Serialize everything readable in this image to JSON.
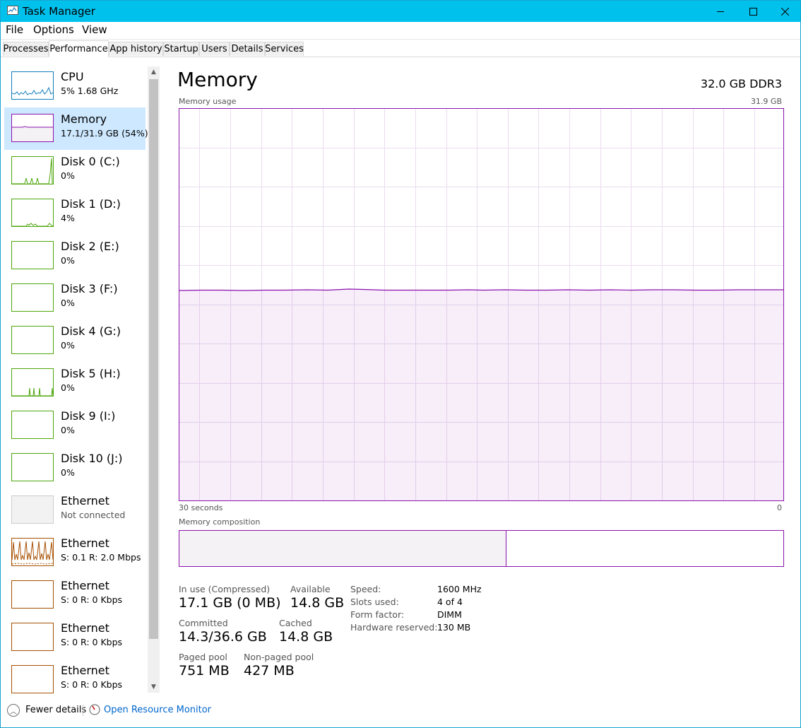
{
  "window": {
    "title": "Task Manager"
  },
  "menu": [
    "File",
    "Options",
    "View"
  ],
  "tabs": [
    "Processes",
    "Performance",
    "App history",
    "Startup",
    "Users",
    "Details",
    "Services"
  ],
  "active_tab": "Performance",
  "sidebar": [
    {
      "name": "CPU",
      "sub": "5%  1.68 GHz"
    },
    {
      "name": "Memory",
      "sub": "17.1/31.9 GB (54%)"
    },
    {
      "name": "Disk 0 (C:)",
      "sub": "0%"
    },
    {
      "name": "Disk 1 (D:)",
      "sub": "4%"
    },
    {
      "name": "Disk 2 (E:)",
      "sub": "0%"
    },
    {
      "name": "Disk 3 (F:)",
      "sub": "0%"
    },
    {
      "name": "Disk 4 (G:)",
      "sub": "0%"
    },
    {
      "name": "Disk 5 (H:)",
      "sub": "0%"
    },
    {
      "name": "Disk 9 (I:)",
      "sub": "0%"
    },
    {
      "name": "Disk 10 (J:)",
      "sub": "0%"
    },
    {
      "name": "Ethernet",
      "sub": "Not connected"
    },
    {
      "name": "Ethernet",
      "sub": "S: 0.1  R: 2.0 Mbps"
    },
    {
      "name": "Ethernet",
      "sub": "S: 0  R: 0 Kbps"
    },
    {
      "name": "Ethernet",
      "sub": "S: 0  R: 0 Kbps"
    },
    {
      "name": "Ethernet",
      "sub": "S: 0  R: 0 Kbps"
    }
  ],
  "main": {
    "title": "Memory",
    "spec": "32.0 GB DDR3",
    "usage_label": "Memory usage",
    "usage_max": "31.9 GB",
    "time_left": "30 seconds",
    "time_right": "0",
    "composition_label": "Memory composition",
    "in_use_fraction": 0.54
  },
  "stats": {
    "in_use_label": "In use (Compressed)",
    "in_use_value": "17.1 GB (0 MB)",
    "available_label": "Available",
    "available_value": "14.8 GB",
    "committed_label": "Committed",
    "committed_value": "14.3/36.6 GB",
    "cached_label": "Cached",
    "cached_value": "14.8 GB",
    "paged_label": "Paged pool",
    "paged_value": "751 MB",
    "nonpaged_label": "Non-paged pool",
    "nonpaged_value": "427 MB"
  },
  "specs": {
    "speed_label": "Speed:",
    "speed_value": "1600 MHz",
    "slots_label": "Slots used:",
    "slots_value": "4 of 4",
    "form_label": "Form factor:",
    "form_value": "DIMM",
    "reserved_label": "Hardware reserved:",
    "reserved_value": "130 MB"
  },
  "footer": {
    "fewer": "Fewer details",
    "resmon": "Open Resource Monitor"
  },
  "colors": {
    "memory": "#8b12ae",
    "cpu": "#117dbb",
    "disk": "#4da60c",
    "ethernet": "#a74f01",
    "titlebar": "#00c0ec"
  }
}
